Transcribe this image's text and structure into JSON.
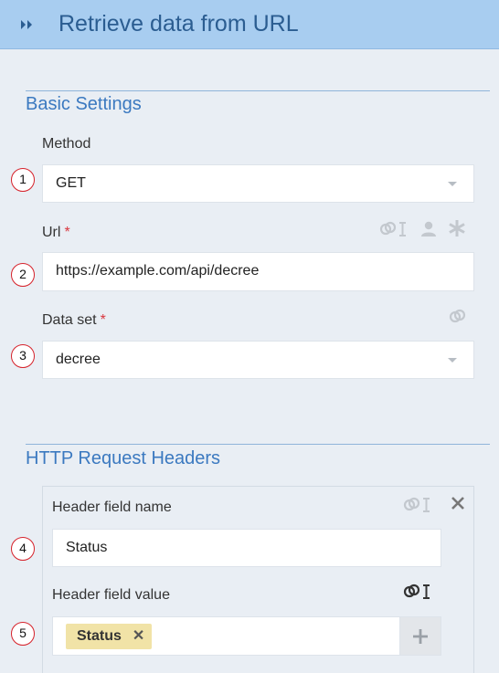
{
  "header": {
    "title": "Retrieve data from URL",
    "collapse_icon": "double-chevron-right-icon"
  },
  "basic_settings": {
    "title": "Basic Settings",
    "method": {
      "label": "Method",
      "value": "GET",
      "marker": "1"
    },
    "url": {
      "label": "Url",
      "required_mark": "*",
      "value": "https://example.com/api/decree",
      "marker": "2",
      "icons": [
        "link-text-icon",
        "user-icon",
        "asterisk-icon"
      ]
    },
    "data_set": {
      "label": "Data set",
      "required_mark": "*",
      "value": "decree",
      "marker": "3",
      "icons": [
        "link-icon"
      ]
    }
  },
  "http_headers": {
    "title": "HTTP Request Headers",
    "field_name": {
      "label": "Header field name",
      "value": "Status",
      "marker": "4"
    },
    "field_value": {
      "label": "Header field value",
      "token": "Status",
      "marker": "5",
      "add_label": "+"
    }
  },
  "colors": {
    "accent": "#3b79c0",
    "header_bg": "#a8cdf0",
    "marker": "#d6212a",
    "token_bg": "#f1e3a7"
  }
}
